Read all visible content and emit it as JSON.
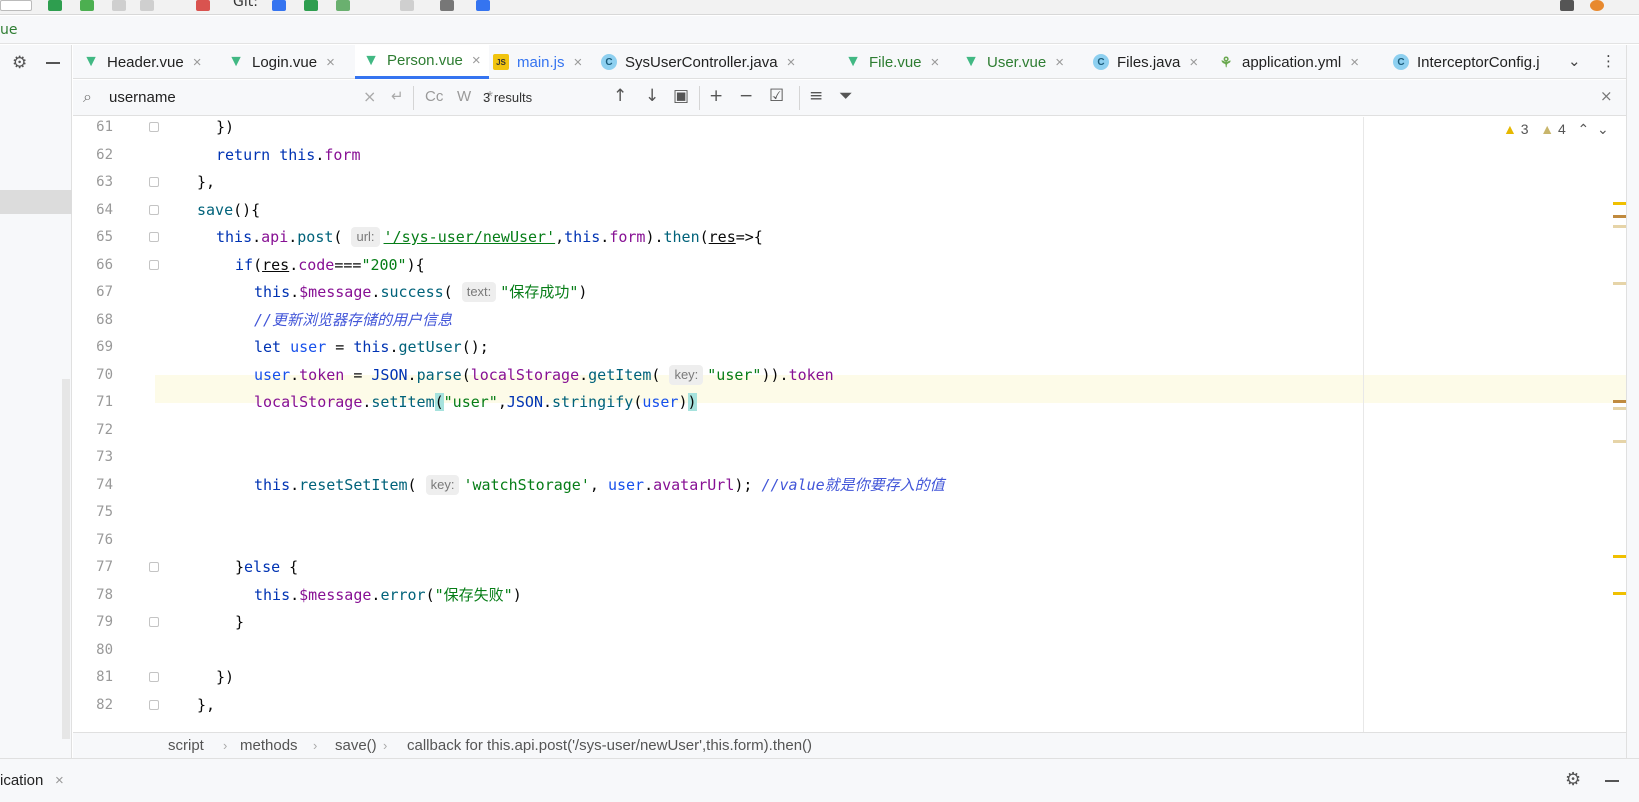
{
  "toolbar": {
    "git_label": "Git:"
  },
  "breadcrumb": "ue",
  "tabs": [
    {
      "label": "Header.vue",
      "type": "vue"
    },
    {
      "label": "Login.vue",
      "type": "vue"
    },
    {
      "label": "Person.vue",
      "type": "vue",
      "active": true
    },
    {
      "label": "main.js",
      "type": "js"
    },
    {
      "label": "SysUserController.java",
      "type": "java"
    },
    {
      "label": "File.vue",
      "type": "vue"
    },
    {
      "label": "User.vue",
      "type": "vue"
    },
    {
      "label": "Files.java",
      "type": "java"
    },
    {
      "label": "application.yml",
      "type": "yml"
    },
    {
      "label": "InterceptorConfig.j",
      "type": "java"
    }
  ],
  "search": {
    "query": "username",
    "results": "3 results",
    "options": [
      "Cc",
      "W",
      ".*"
    ]
  },
  "inspections": {
    "warnings": "3",
    "weak_warnings": "4"
  },
  "line_numbers": [
    "61",
    "62",
    "63",
    "64",
    "65",
    "66",
    "67",
    "68",
    "69",
    "70",
    "71",
    "72",
    "73",
    "74",
    "75",
    "76",
    "77",
    "78",
    "79",
    "80",
    "81",
    "82"
  ],
  "code": {
    "l74_comment": "//value就是你要存入的值",
    "l68_comment": "//更新浏览器存储的用户信息",
    "s_url": "'/sys-user/newUser'",
    "s_200": "\"200\"",
    "s_success": "\"保存成功\"",
    "s_user": "\"user\"",
    "s_watch": "'watchStorage'",
    "s_error": "\"保存失败\"",
    "hint_url": "url:",
    "hint_text": "text:",
    "hint_key": "key:"
  },
  "status_crumbs": [
    "script",
    "methods",
    "save()",
    "callback for this.api.post('/sys-user/newUser',this.form).then()"
  ],
  "bottom": {
    "label": "ication"
  },
  "colors": {
    "accent": "#3574f0",
    "vue": "#41b883",
    "warning": "#e6b800"
  }
}
